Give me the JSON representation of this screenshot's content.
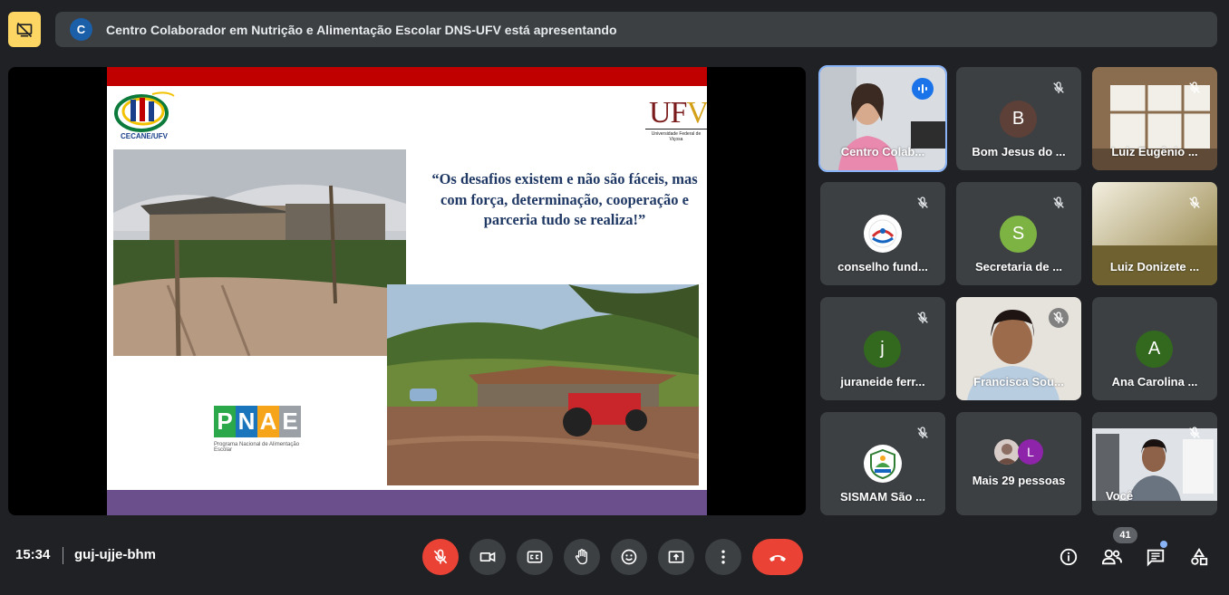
{
  "banner": {
    "avatar_letter": "C",
    "text": "Centro Colaborador em Nutrição e Alimentação Escolar DNS-UFV está apresentando"
  },
  "slide": {
    "cecane_label": "CECANE/UFV",
    "ufv_logo_text": "UF",
    "ufv_logo_v": "V",
    "ufv_subtitle": "Universidade Federal de Viçosa",
    "quote": "“Os desafios existem e não são fáceis, mas com força, determinação, cooperação e parceria tudo se realiza!”",
    "pnae_letters": [
      "P",
      "N",
      "A",
      "E"
    ],
    "pnae_subtitle": "Programa Nacional de Alimentação Escolar"
  },
  "participants": [
    {
      "name": "Centro Colab...",
      "type": "video",
      "speaking": true
    },
    {
      "name": "Bom Jesus do ...",
      "avatar": "B",
      "avatar_color": "#5d4037"
    },
    {
      "name": "Luiz Eugênio ...",
      "type": "video"
    },
    {
      "name": "conselho fund...",
      "type": "logo"
    },
    {
      "name": "Secretaria de ...",
      "avatar": "S",
      "avatar_color": "#7cb342"
    },
    {
      "name": "Luiz Donizete ...",
      "type": "video"
    },
    {
      "name": "juraneide ferr...",
      "avatar": "j",
      "avatar_color": "#33691e"
    },
    {
      "name": "Francisca Sou...",
      "type": "video"
    },
    {
      "name": "Ana Carolina ...",
      "avatar": "A",
      "avatar_color": "#33691e"
    },
    {
      "name": "SISMAM São ...",
      "type": "logo"
    },
    {
      "name": "Mais 29 pessoas",
      "avatar": "L",
      "avatar_color": "#8e24aa"
    },
    {
      "name": "Você",
      "type": "video"
    }
  ],
  "bottom_bar": {
    "time": "15:34",
    "meeting_code": "guj-ujje-bhm",
    "participant_count": "41"
  },
  "colors": {
    "accent": "#8ab4f8",
    "danger": "#ea4335",
    "banner_button": "#fdd663"
  }
}
